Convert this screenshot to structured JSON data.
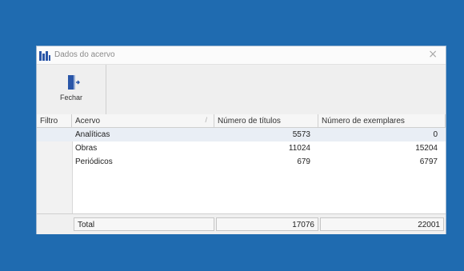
{
  "window": {
    "title": "Dados do acervo",
    "close_glyph": "×"
  },
  "toolbar": {
    "close_label": "Fechar"
  },
  "grid": {
    "headers": {
      "filtro": "Filtro",
      "acervo": "Acervo",
      "titulos": "Número de títulos",
      "exemplares": "Número de exemplares"
    },
    "rows": [
      {
        "acervo": "Analíticas",
        "titulos": "5573",
        "exemplares": "0"
      },
      {
        "acervo": "Obras",
        "titulos": "11024",
        "exemplares": "15204"
      },
      {
        "acervo": "Periódicos",
        "titulos": "679",
        "exemplares": "6797"
      }
    ],
    "total": {
      "label": "Total",
      "titulos": "17076",
      "exemplares": "22001"
    }
  },
  "colors": {
    "background": "#1f6bb0",
    "icon_blue": "#2a56a8"
  }
}
